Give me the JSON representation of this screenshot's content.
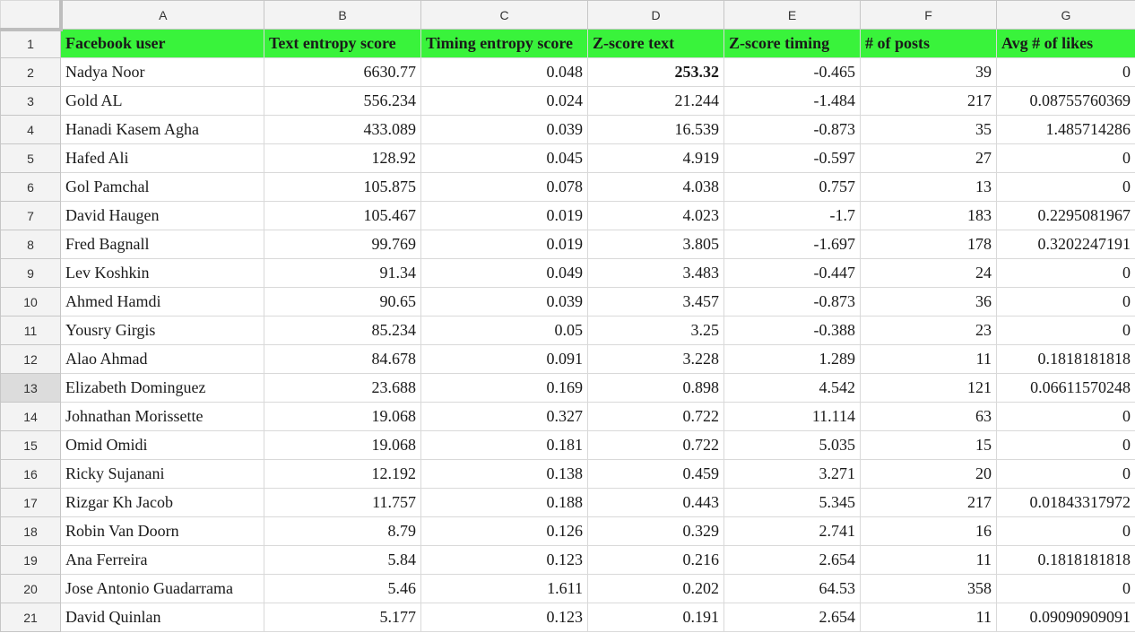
{
  "columns": [
    "A",
    "B",
    "C",
    "D",
    "E",
    "F",
    "G"
  ],
  "header": [
    "Facebook user",
    "Text entropy score",
    "Timing entropy score",
    "Z-score text",
    "Z-score timing",
    "# of posts",
    "Avg # of likes"
  ],
  "rows": [
    {
      "n": "2",
      "name": "Nadya Noor",
      "text": "6630.77",
      "timing": "0.048",
      "zt": "253.32",
      "ztim": "-0.465",
      "posts": "39",
      "likes": "0"
    },
    {
      "n": "3",
      "name": "Gold AL",
      "text": "556.234",
      "timing": "0.024",
      "zt": "21.244",
      "ztim": "-1.484",
      "posts": "217",
      "likes": "0.08755760369"
    },
    {
      "n": "4",
      "name": "Hanadi Kasem Agha",
      "text": "433.089",
      "timing": "0.039",
      "zt": "16.539",
      "ztim": "-0.873",
      "posts": "35",
      "likes": "1.485714286"
    },
    {
      "n": "5",
      "name": "Hafed Ali",
      "text": "128.92",
      "timing": "0.045",
      "zt": "4.919",
      "ztim": "-0.597",
      "posts": "27",
      "likes": "0"
    },
    {
      "n": "6",
      "name": "Gol Pamchal",
      "text": "105.875",
      "timing": "0.078",
      "zt": "4.038",
      "ztim": "0.757",
      "posts": "13",
      "likes": "0"
    },
    {
      "n": "7",
      "name": "David Haugen",
      "text": "105.467",
      "timing": "0.019",
      "zt": "4.023",
      "ztim": "-1.7",
      "posts": "183",
      "likes": "0.2295081967"
    },
    {
      "n": "8",
      "name": "Fred Bagnall",
      "text": "99.769",
      "timing": "0.019",
      "zt": "3.805",
      "ztim": "-1.697",
      "posts": "178",
      "likes": "0.3202247191"
    },
    {
      "n": "9",
      "name": "Lev Koshkin",
      "text": "91.34",
      "timing": "0.049",
      "zt": "3.483",
      "ztim": "-0.447",
      "posts": "24",
      "likes": "0"
    },
    {
      "n": "10",
      "name": "Ahmed Hamdi",
      "text": "90.65",
      "timing": "0.039",
      "zt": "3.457",
      "ztim": "-0.873",
      "posts": "36",
      "likes": "0"
    },
    {
      "n": "11",
      "name": "Yousry Girgis",
      "text": "85.234",
      "timing": "0.05",
      "zt": "3.25",
      "ztim": "-0.388",
      "posts": "23",
      "likes": "0"
    },
    {
      "n": "12",
      "name": "Alao Ahmad",
      "text": "84.678",
      "timing": "0.091",
      "zt": "3.228",
      "ztim": "1.289",
      "posts": "11",
      "likes": "0.1818181818"
    },
    {
      "n": "13",
      "name": "Elizabeth Dominguez",
      "text": "23.688",
      "timing": "0.169",
      "zt": "0.898",
      "ztim": "4.542",
      "posts": "121",
      "likes": "0.06611570248"
    },
    {
      "n": "14",
      "name": "Johnathan Morissette",
      "text": "19.068",
      "timing": "0.327",
      "zt": "0.722",
      "ztim": "11.114",
      "posts": "63",
      "likes": "0"
    },
    {
      "n": "15",
      "name": "Omid Omidi",
      "text": "19.068",
      "timing": "0.181",
      "zt": "0.722",
      "ztim": "5.035",
      "posts": "15",
      "likes": "0"
    },
    {
      "n": "16",
      "name": "Ricky Sujanani",
      "text": "12.192",
      "timing": "0.138",
      "zt": "0.459",
      "ztim": "3.271",
      "posts": "20",
      "likes": "0"
    },
    {
      "n": "17",
      "name": "Rizgar Kh Jacob",
      "text": "11.757",
      "timing": "0.188",
      "zt": "0.443",
      "ztim": "5.345",
      "posts": "217",
      "likes": "0.01843317972"
    },
    {
      "n": "18",
      "name": "Robin Van Doorn",
      "text": "8.79",
      "timing": "0.126",
      "zt": "0.329",
      "ztim": "2.741",
      "posts": "16",
      "likes": "0"
    },
    {
      "n": "19",
      "name": "Ana Ferreira",
      "text": "5.84",
      "timing": "0.123",
      "zt": "0.216",
      "ztim": "2.654",
      "posts": "11",
      "likes": "0.1818181818"
    },
    {
      "n": "20",
      "name": "Jose Antonio Guadarrama",
      "text": "5.46",
      "timing": "1.611",
      "zt": "0.202",
      "ztim": "64.53",
      "posts": "358",
      "likes": "0"
    },
    {
      "n": "21",
      "name": "David Quinlan",
      "text": "5.177",
      "timing": "0.123",
      "zt": "0.191",
      "ztim": "2.654",
      "posts": "11",
      "likes": "0.09090909091"
    }
  ],
  "selected_row": "13",
  "bold_cell": "D2",
  "header_fill": "#39f33b"
}
